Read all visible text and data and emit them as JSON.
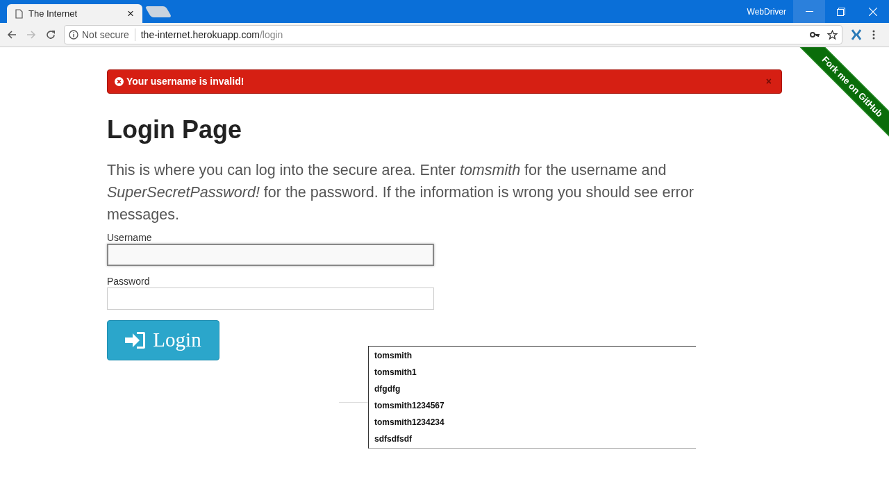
{
  "browser": {
    "tab": {
      "title": "The Internet",
      "close": "×",
      "selected": true
    },
    "profile": "WebDriver",
    "security": "Not secure",
    "url_host": "the-internet.herokuapp.com",
    "url_path": "/login"
  },
  "page": {
    "alert": {
      "message": "Your username is invalid!",
      "close": "×"
    },
    "ribbon": "Fork me on GitHub",
    "heading": "Login Page",
    "intro": "This is where you can log into the secure area. Enter *tomsmith* for the username and *SuperSecretPassword!* for the password. If the information is wrong you should see error messages.",
    "fields": [
      {
        "label": "Username",
        "focused": true
      },
      {
        "label": "Password",
        "focused": false
      }
    ],
    "login_button": "Login"
  },
  "autocomplete": [
    {
      "text": "tomsmith"
    },
    {
      "text": "tomsmith1"
    },
    {
      "text": "dfgdfg"
    },
    {
      "text": "tomsmith1234567"
    },
    {
      "text": "tomsmith1234234"
    },
    {
      "text": "sdfsdfsdf"
    }
  ]
}
